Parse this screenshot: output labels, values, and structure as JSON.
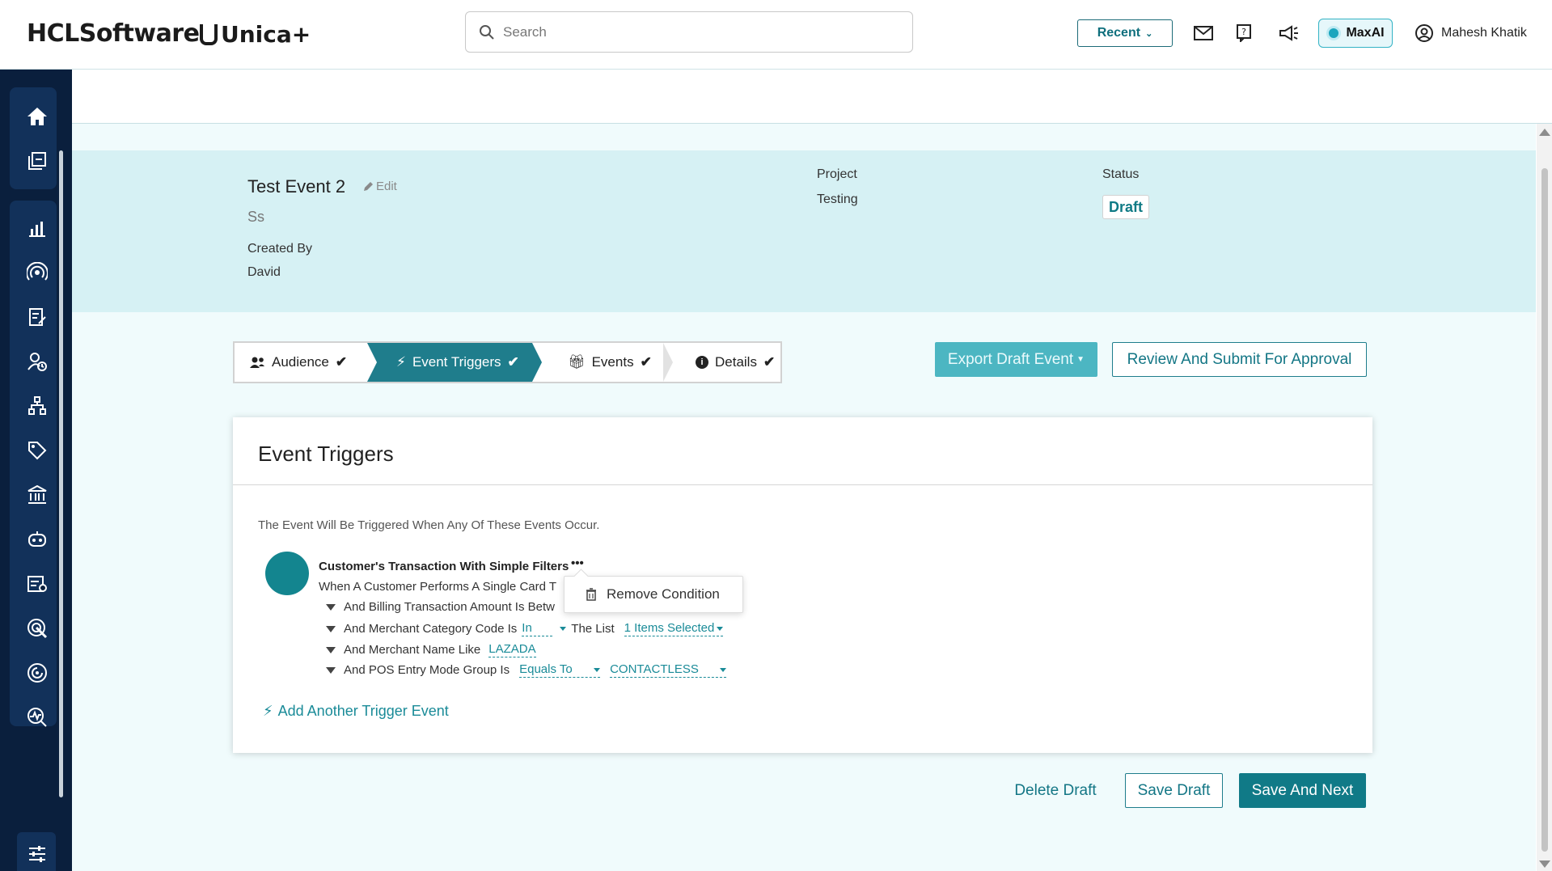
{
  "header": {
    "brand": "HCLSoftware",
    "product": "Unica+",
    "search_placeholder": "Search",
    "recent_label": "Recent",
    "maxai_label": "MaxAI",
    "user_name": "Mahesh Khatik",
    "icons": [
      "mail-icon",
      "help-icon",
      "announcement-icon"
    ]
  },
  "sidebar": {
    "items": [
      "home-icon",
      "campaigns-icon",
      "analytics-icon",
      "broadcast-icon",
      "forms-icon",
      "audience-icon",
      "hierarchy-icon",
      "offers-icon",
      "bank-icon",
      "bot-icon",
      "reports-icon",
      "target-icon",
      "goals-icon",
      "insights-icon",
      "settings-icon",
      "unlock-icon"
    ]
  },
  "event": {
    "name": "Test Event 2",
    "edit_label": "Edit",
    "description": "Ss",
    "created_by_label": "Created By",
    "created_by": "David",
    "project_label": "Project",
    "project": "Testing",
    "status_label": "Status",
    "status": "Draft"
  },
  "stepper": {
    "steps": [
      "Audience",
      "Event Triggers",
      "Events",
      "Details"
    ],
    "active_index": 1
  },
  "actions": {
    "export_label": "Export Draft Event",
    "review_label": "Review And Submit For Approval",
    "delete_label": "Delete Draft",
    "save_label": "Save Draft",
    "next_label": "Save And Next"
  },
  "triggers": {
    "title": "Event Triggers",
    "intro": "The Event Will Be Triggered When Any Of These Events Occur.",
    "trigger_name": "Customer's Transaction With Simple Filters",
    "trigger_desc": "When A Customer Performs A Single Card T",
    "conditions": [
      {
        "text": "And Billing Transaction Amount Is Betw"
      },
      {
        "text": "And Merchant Category Code Is",
        "op": "In",
        "mid": "The List",
        "value": "1 Items Selected"
      },
      {
        "text": "And Merchant Name Like",
        "value": "LAZADA"
      },
      {
        "text": "And POS Entry Mode Group Is",
        "op": "Equals To",
        "value": "CONTACTLESS"
      }
    ],
    "add_label": "Add Another Trigger Event",
    "popover_label": "Remove Condition"
  },
  "colors": {
    "accent": "#1f7d8c",
    "sidebar": "#0a1f3d",
    "hero": "#d6f1f4"
  }
}
